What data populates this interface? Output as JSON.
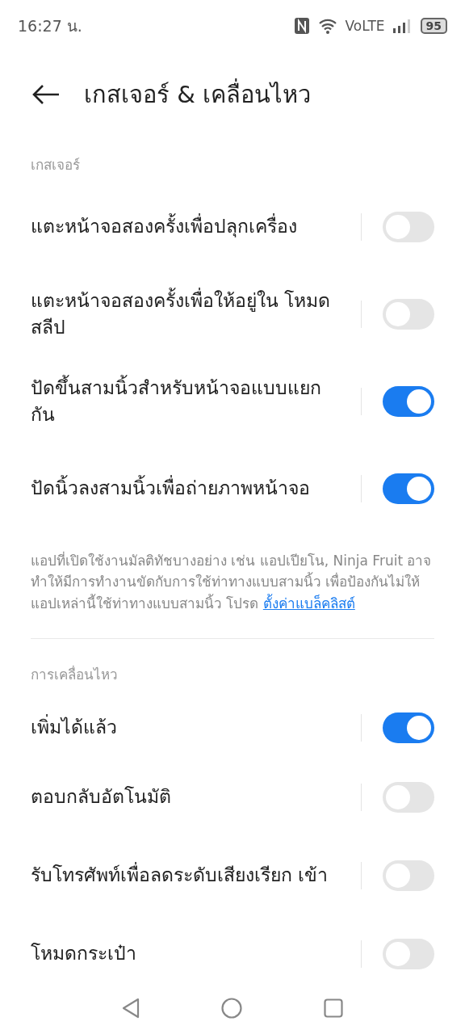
{
  "status_bar": {
    "time": "16:27 น.",
    "network": "VoLTE",
    "battery": "95"
  },
  "header": {
    "title": "เกสเจอร์ & เคลื่อนไหว"
  },
  "sections": [
    {
      "label": "เกสเจอร์",
      "items": [
        {
          "label": "แตะหน้าจอสองครั้งเพื่อปลุกเครื่อง",
          "on": false
        },
        {
          "label": "แตะหน้าจอสองครั้งเพื่อให้อยู่ใน โหมดสลีป",
          "on": false
        },
        {
          "label": "ปัดขึ้นสามนิ้วสำหรับหน้าจอแบบแยก กัน",
          "on": true
        },
        {
          "label": "ปัดนิ้วลงสามนิ้วเพื่อถ่ายภาพหน้าจอ",
          "on": true
        }
      ],
      "note": {
        "text": "แอปที่เปิดใช้งานมัลติทัชบางอย่าง เช่น แอปเปียโน, Ninja Fruit อาจทำให้มีการทำงานขัดกับการใช้ท่าทางแบบสามนิ้ว เพื่อป้องกันไม่ให้แอปเหล่านี้ใช้ท่าทางแบบสามนิ้ว โปรด",
        "link": "ตั้งค่าแบล็คลิสต์"
      }
    },
    {
      "label": "การเคลื่อนไหว",
      "items": [
        {
          "label": "เพิ่มได้แล้ว",
          "on": true
        },
        {
          "label": "ตอบกลับอัตโนมัติ",
          "on": false
        },
        {
          "label": "รับโทรศัพท์เพื่อลดระดับเสียงเรียก เข้า",
          "on": false
        },
        {
          "label": "โหมดกระเป๋า",
          "on": false
        }
      ]
    }
  ]
}
